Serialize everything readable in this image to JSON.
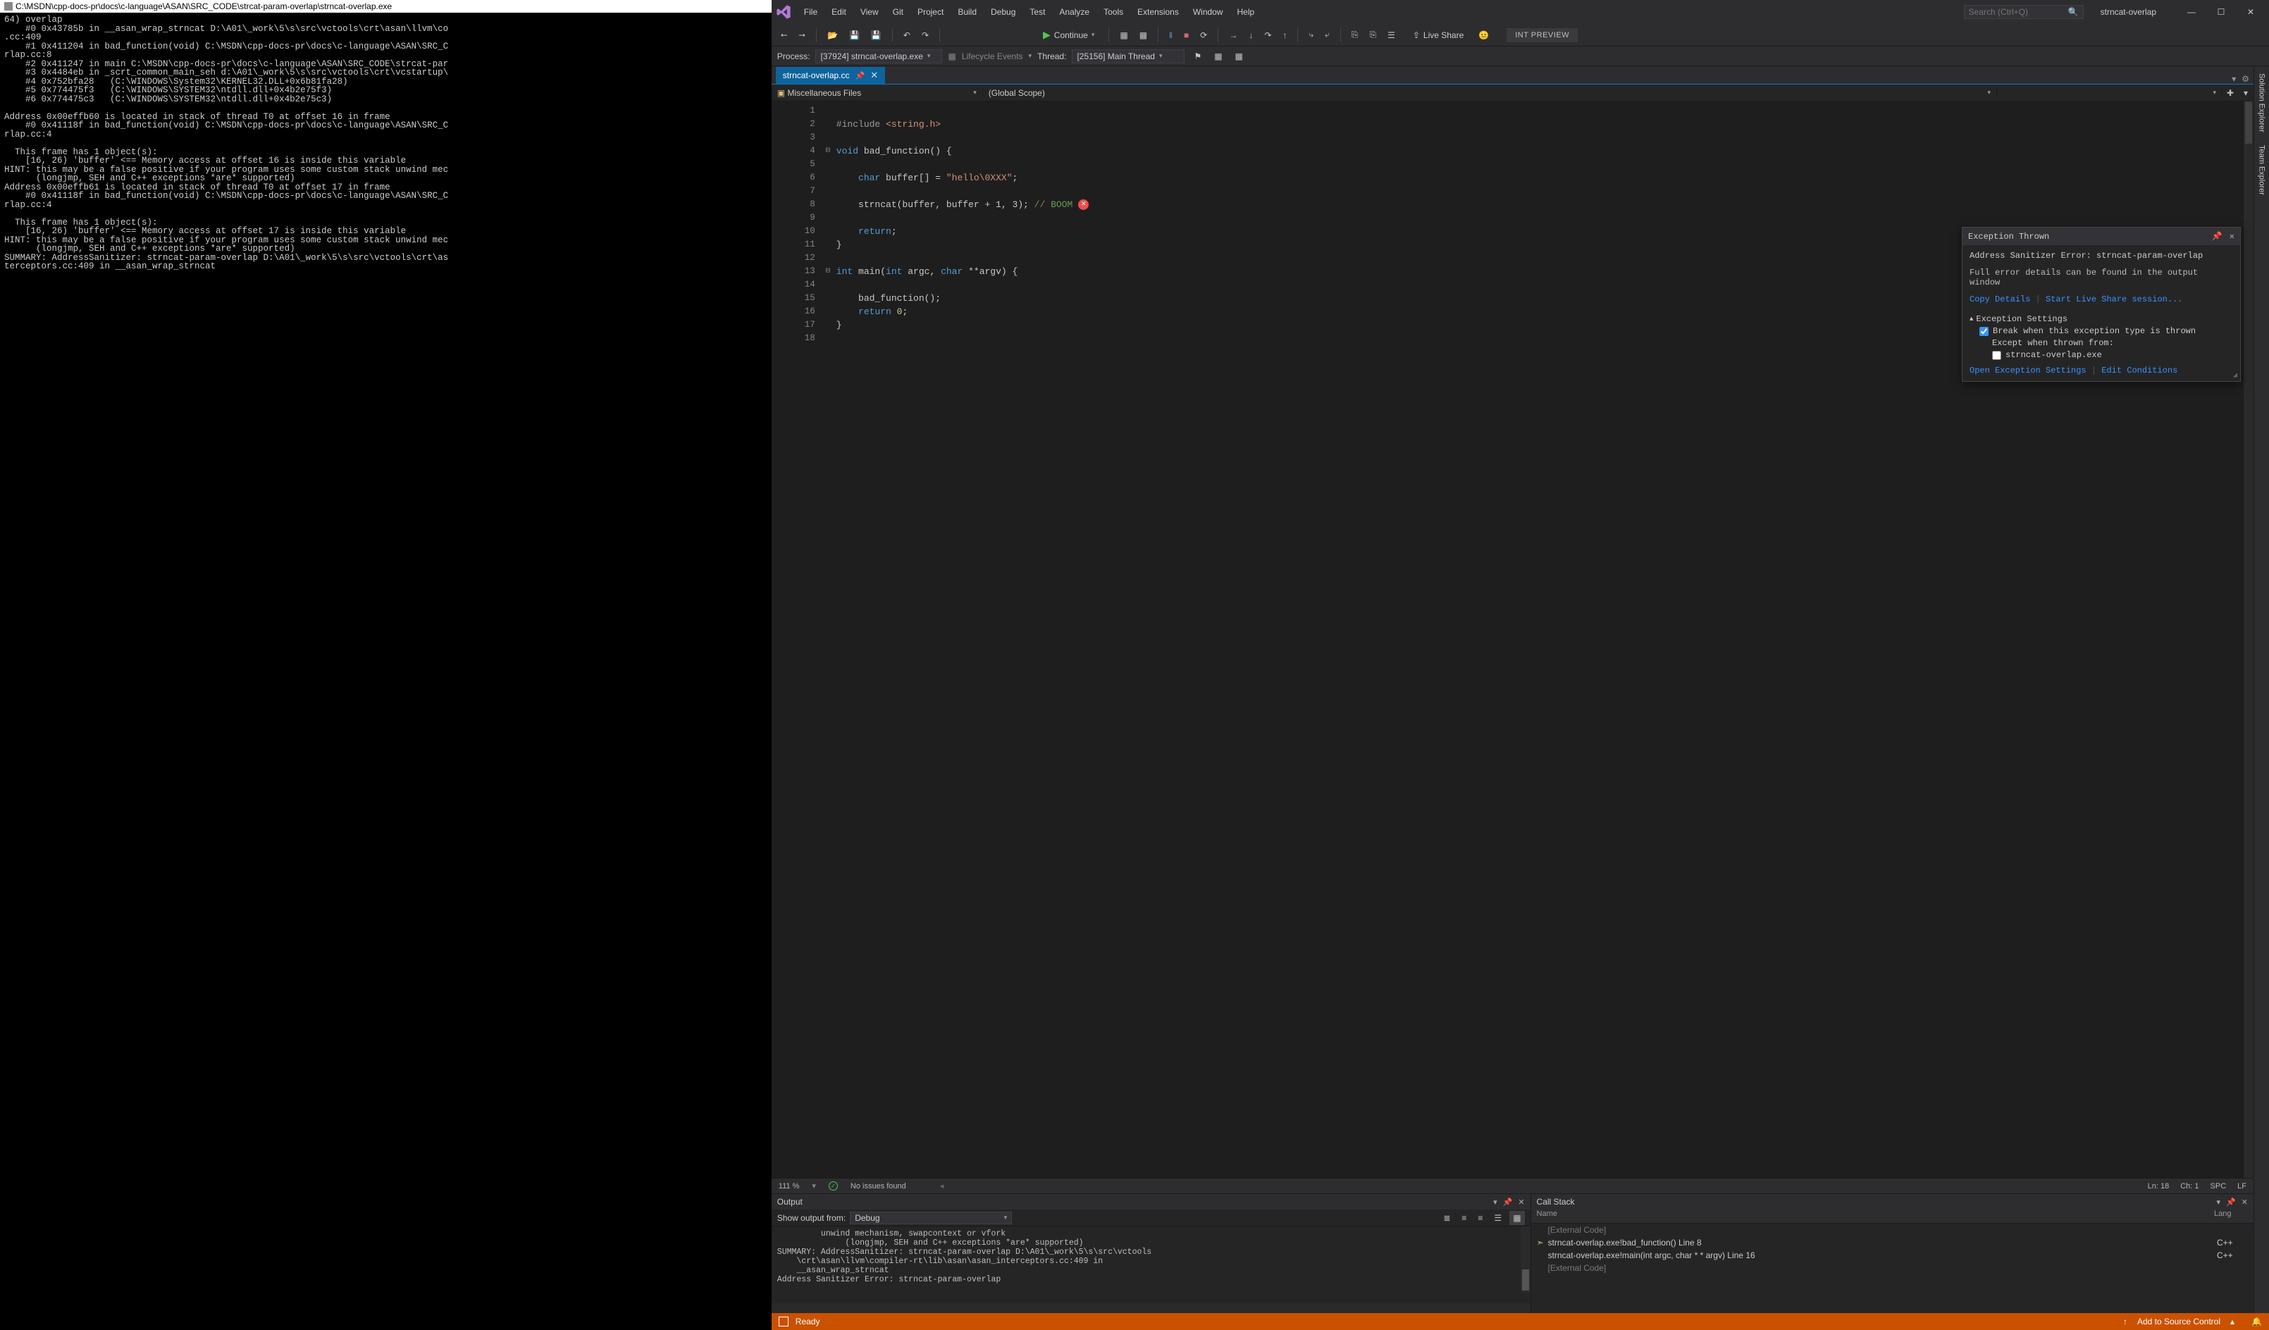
{
  "console": {
    "title": "C:\\MSDN\\cpp-docs-pr\\docs\\c-language\\ASAN\\SRC_CODE\\strcat-param-overlap\\strncat-overlap.exe",
    "secondary": "",
    "body_lines": [
      "64) overlap",
      "    #0 0x43785b in __asan_wrap_strncat D:\\A01\\_work\\5\\s\\src\\vctools\\crt\\asan\\llvm\\co",
      ".cc:409",
      "    #1 0x411204 in bad_function(void) C:\\MSDN\\cpp-docs-pr\\docs\\c-language\\ASAN\\SRC_C",
      "rlap.cc:8",
      "    #2 0x411247 in main C:\\MSDN\\cpp-docs-pr\\docs\\c-language\\ASAN\\SRC_CODE\\strcat-par",
      "    #3 0x4484eb in _scrt_common_main_seh d:\\A01\\_work\\5\\s\\src\\vctools\\crt\\vcstartup\\",
      "    #4 0x752bfa28   (C:\\WINDOWS\\System32\\KERNEL32.DLL+0x6b81fa28)",
      "    #5 0x774475f3   (C:\\WINDOWS\\SYSTEM32\\ntdll.dll+0x4b2e75f3)",
      "    #6 0x774475c3   (C:\\WINDOWS\\SYSTEM32\\ntdll.dll+0x4b2e75c3)",
      "",
      "Address 0x00effb60 is located in stack of thread T0 at offset 16 in frame",
      "    #0 0x41118f in bad_function(void) C:\\MSDN\\cpp-docs-pr\\docs\\c-language\\ASAN\\SRC_C",
      "rlap.cc:4",
      "",
      "  This frame has 1 object(s):",
      "    [16, 26) 'buffer' <== Memory access at offset 16 is inside this variable",
      "HINT: this may be a false positive if your program uses some custom stack unwind mec",
      "      (longjmp, SEH and C++ exceptions *are* supported)",
      "Address 0x00effb61 is located in stack of thread T0 at offset 17 in frame",
      "    #0 0x41118f in bad_function(void) C:\\MSDN\\cpp-docs-pr\\docs\\c-language\\ASAN\\SRC_C",
      "rlap.cc:4",
      "",
      "  This frame has 1 object(s):",
      "    [16, 26) 'buffer' <== Memory access at offset 17 is inside this variable",
      "HINT: this may be a false positive if your program uses some custom stack unwind mec",
      "      (longjmp, SEH and C++ exceptions *are* supported)",
      "SUMMARY: AddressSanitizer: strncat-param-overlap D:\\A01\\_work\\5\\s\\src\\vctools\\crt\\as",
      "terceptors.cc:409 in __asan_wrap_strncat"
    ]
  },
  "vs": {
    "menu": [
      "File",
      "Edit",
      "View",
      "Git",
      "Project",
      "Build",
      "Debug",
      "Test",
      "Analyze",
      "Tools",
      "Extensions",
      "Window",
      "Help"
    ],
    "search_placeholder": "Search (Ctrl+Q)",
    "solution": "strncat-overlap",
    "toolbar": {
      "continue": "Continue",
      "live_share": "Live Share",
      "int_preview": "INT PREVIEW"
    },
    "process": {
      "label": "Process:",
      "value": "[37924] strncat-overlap.exe",
      "lifecycle": "Lifecycle Events",
      "thread_label": "Thread:",
      "thread_value": "[25156] Main Thread"
    },
    "tab": {
      "name": "strncat-overlap.cc"
    },
    "nav": {
      "left": "Miscellaneous Files",
      "mid": "(Global Scope)",
      "right": ""
    },
    "sidetabs": [
      "Solution Explorer",
      "Team Explorer"
    ],
    "editor": {
      "zoom": "111 %",
      "issues": "No issues found",
      "cursor": {
        "ln": "Ln: 18",
        "ch": "Ch: 1",
        "spc": "SPC",
        "lf": "LF"
      },
      "lines": [
        {
          "n": 1,
          "html": ""
        },
        {
          "n": 2,
          "html": "<span class='pp'>#include</span> <span class='str'>&lt;string.h&gt;</span>"
        },
        {
          "n": 3,
          "html": ""
        },
        {
          "n": 4,
          "html": "<span class='kw'>void</span> <span class='txt'>bad_function() {</span>"
        },
        {
          "n": 5,
          "html": ""
        },
        {
          "n": 6,
          "html": "    <span class='kw'>char</span> <span class='txt'>buffer[] = </span><span class='str'>\"hello\\0XXX\"</span><span class='txt'>;</span>"
        },
        {
          "n": 7,
          "html": ""
        },
        {
          "n": 8,
          "html": "    <span class='txt'>strncat(buffer, buffer + 1, 3);</span> <span class='com'>// BOOM</span><span class='err-glyph'>✕</span>"
        },
        {
          "n": 9,
          "html": ""
        },
        {
          "n": 10,
          "html": "    <span class='kw'>return</span><span class='txt'>;</span>"
        },
        {
          "n": 11,
          "html": "<span class='txt'>}</span>"
        },
        {
          "n": 12,
          "html": ""
        },
        {
          "n": 13,
          "html": "<span class='kw'>int</span> <span class='txt'>main(</span><span class='kw'>int</span> <span class='txt'>argc, </span><span class='kw'>char</span> <span class='txt'>**argv) {</span>"
        },
        {
          "n": 14,
          "html": ""
        },
        {
          "n": 15,
          "html": "    <span class='txt'>bad_function();</span>"
        },
        {
          "n": 16,
          "html": "    <span class='kw'>return</span> <span class='num'>0</span><span class='txt'>;</span>"
        },
        {
          "n": 17,
          "html": "<span class='txt'>}</span>"
        },
        {
          "n": 18,
          "html": ""
        }
      ],
      "fold": {
        "4": "⊟",
        "13": "⊟"
      }
    },
    "exception": {
      "title": "Exception Thrown",
      "error": "Address Sanitizer Error: strncat-param-overlap",
      "hint": "Full error details can be found in the output window",
      "copy": "Copy Details",
      "start_share": "Start Live Share session...",
      "settings_head": "Exception Settings",
      "break_when": "Break when this exception type is thrown",
      "except_from": "Except when thrown from:",
      "exe": "strncat-overlap.exe",
      "open_settings": "Open Exception Settings",
      "edit_cond": "Edit Conditions"
    },
    "output": {
      "title": "Output",
      "show_from_label": "Show output from:",
      "show_from_value": "Debug",
      "lines": [
        "         unwind mechanism, swapcontext or vfork",
        "              (longjmp, SEH and C++ exceptions *are* supported)",
        "SUMMARY: AddressSanitizer: strncat-param-overlap D:\\A01\\_work\\5\\s\\src\\vctools",
        "    \\crt\\asan\\llvm\\compiler-rt\\lib\\asan\\asan_interceptors.cc:409 in",
        "    __asan_wrap_strncat",
        "Address Sanitizer Error: strncat-param-overlap"
      ]
    },
    "callstack": {
      "title": "Call Stack",
      "cols": {
        "name": "Name",
        "lang": "Lang"
      },
      "rows": [
        {
          "name": "[External Code]",
          "lang": "",
          "ext": true,
          "active": false
        },
        {
          "name": "strncat-overlap.exe!bad_function() Line 8",
          "lang": "C++",
          "ext": false,
          "active": true
        },
        {
          "name": "strncat-overlap.exe!main(int argc, char * * argv) Line 16",
          "lang": "C++",
          "ext": false,
          "active": false
        },
        {
          "name": "[External Code]",
          "lang": "",
          "ext": true,
          "active": false
        }
      ]
    },
    "status": {
      "ready": "Ready",
      "add_src": "Add to Source Control"
    }
  }
}
